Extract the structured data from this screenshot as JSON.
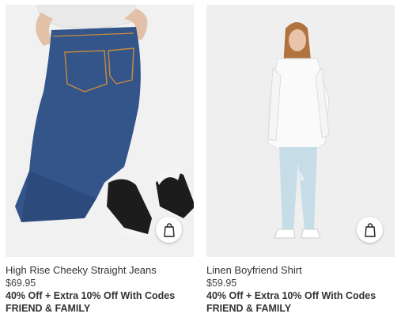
{
  "products": [
    {
      "name": "High Rise Cheeky Straight Jeans",
      "price": "$69.95",
      "promo_line1": "40% Off + Extra 10% Off With Codes",
      "promo_line2": "FRIEND & FAMILY",
      "bag_icon": "shopping-bag-icon"
    },
    {
      "name": "Linen Boyfriend Shirt",
      "price": "$59.95",
      "promo_line1": "40% Off + Extra 10% Off With Codes",
      "promo_line2": "FRIEND & FAMILY",
      "bag_icon": "shopping-bag-icon"
    }
  ]
}
